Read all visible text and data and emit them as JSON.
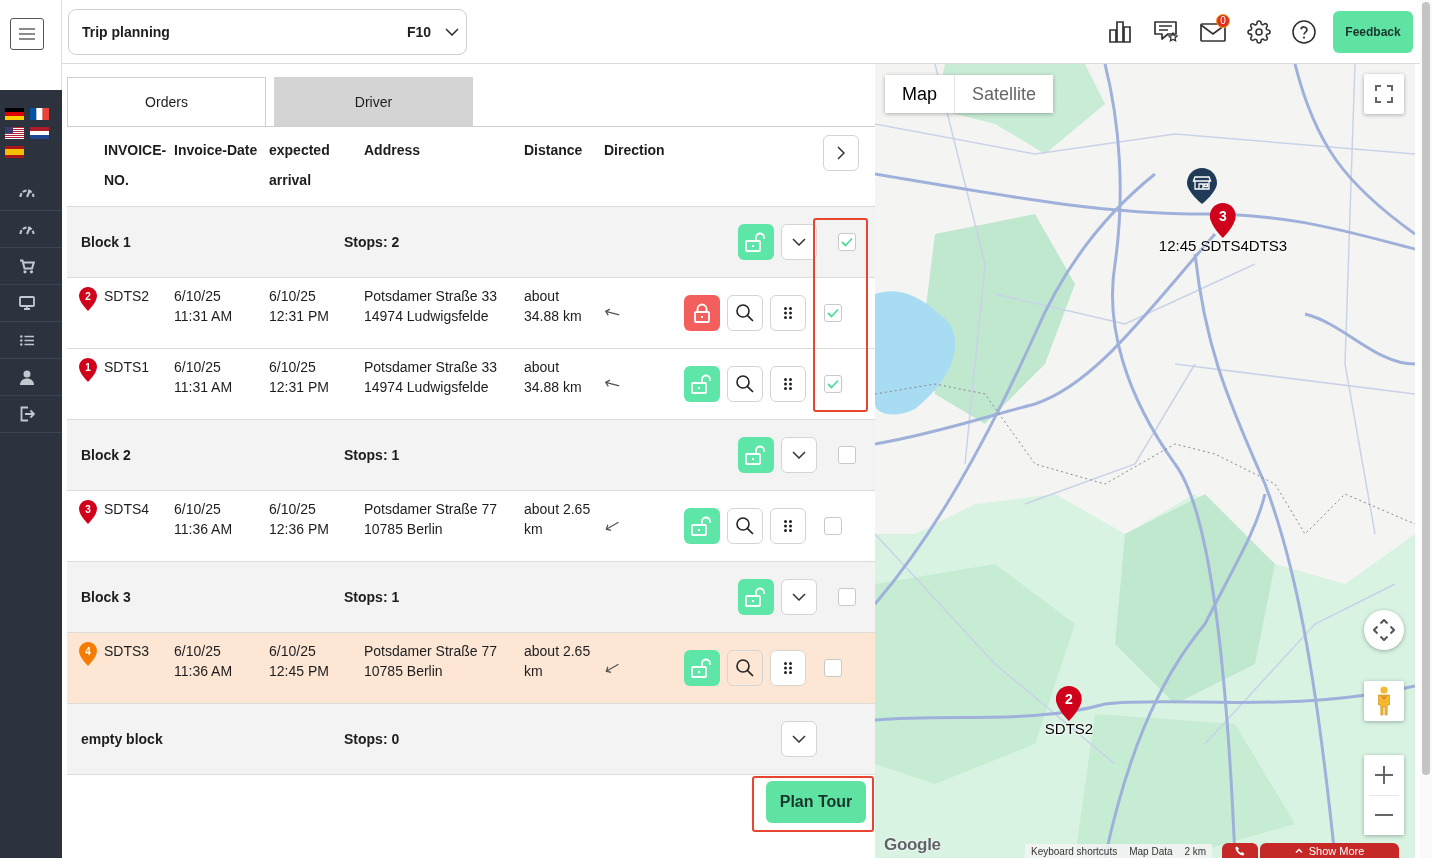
{
  "top_bar": {
    "module_select": {
      "value": "Trip planning",
      "shortcut": "F10"
    },
    "mail_badge": "0",
    "feedback_button": "Feedback"
  },
  "tabs": [
    {
      "label": "Orders",
      "selected": true
    },
    {
      "label": "Driver",
      "selected": false
    }
  ],
  "table": {
    "columns": [
      "INVOICE-NO.",
      "Invoice-Date",
      "expected arrival",
      "Address",
      "Distance",
      "Direction"
    ],
    "blocks": [
      {
        "name": "Block 1",
        "stops": "Stops: 2",
        "locked": false,
        "checked": true,
        "orders": [
          {
            "pin": "2",
            "color": "#d0021b",
            "invoice": "SDTS2",
            "invoice_date": "6/10/25 11:31 AM",
            "expected_arrival": "6/10/25 12:31 PM",
            "address": "Potsdamer Straße 33 14974 Ludwigsfelde",
            "distance": "about 34.88 km",
            "direction": {
              "kind": "northwest"
            },
            "locked": true,
            "checked": true,
            "selected": false
          },
          {
            "pin": "1",
            "color": "#d0021b",
            "invoice": "SDTS1",
            "invoice_date": "6/10/25 11:31 AM",
            "expected_arrival": "6/10/25 12:31 PM",
            "address": "Potsdamer Straße 33 14974 Ludwigsfelde",
            "distance": "about 34.88 km",
            "direction": {
              "kind": "northwest"
            },
            "locked": false,
            "checked": true,
            "selected": false
          }
        ]
      },
      {
        "name": "Block 2",
        "stops": "Stops: 1",
        "locked": false,
        "checked": false,
        "orders": [
          {
            "pin": "3",
            "color": "#d0021b",
            "invoice": "SDTS4",
            "invoice_date": "6/10/25 11:36 AM",
            "expected_arrival": "6/10/25 12:36 PM",
            "address": "Potsdamer Straße 77 10785 Berlin",
            "distance": "about 2.65 km",
            "direction": {
              "kind": "southwest"
            },
            "locked": false,
            "checked": false,
            "selected": false
          }
        ]
      },
      {
        "name": "Block 3",
        "stops": "Stops: 1",
        "locked": false,
        "checked": false,
        "orders": [
          {
            "pin": "4",
            "color": "#f57c00",
            "invoice": "SDTS3",
            "invoice_date": "6/10/25 11:36 AM",
            "expected_arrival": "6/10/25 12:45 PM",
            "address": "Potsdamer Straße 77 10785 Berlin",
            "distance": "about 2.65 km",
            "direction": {
              "kind": "southwest"
            },
            "locked": false,
            "checked": false,
            "selected": true
          }
        ]
      },
      {
        "name": "empty block",
        "stops": "Stops: 0"
      }
    ]
  },
  "plan_button": "Plan Tour",
  "map": {
    "map_types": [
      {
        "label": "Map",
        "selected": true
      },
      {
        "label": "Satellite",
        "selected": false
      }
    ],
    "markers": [
      {
        "kind": "store"
      },
      {
        "kind": "stop",
        "number": "3",
        "label": "12:45 SDTS4DTS3"
      },
      {
        "kind": "stop",
        "number": "2",
        "label": "SDTS2"
      }
    ],
    "logo": "Google",
    "attribution": [
      "Keyboard shortcuts",
      "Map Data",
      "2 km"
    ],
    "show_more": "Show More"
  }
}
